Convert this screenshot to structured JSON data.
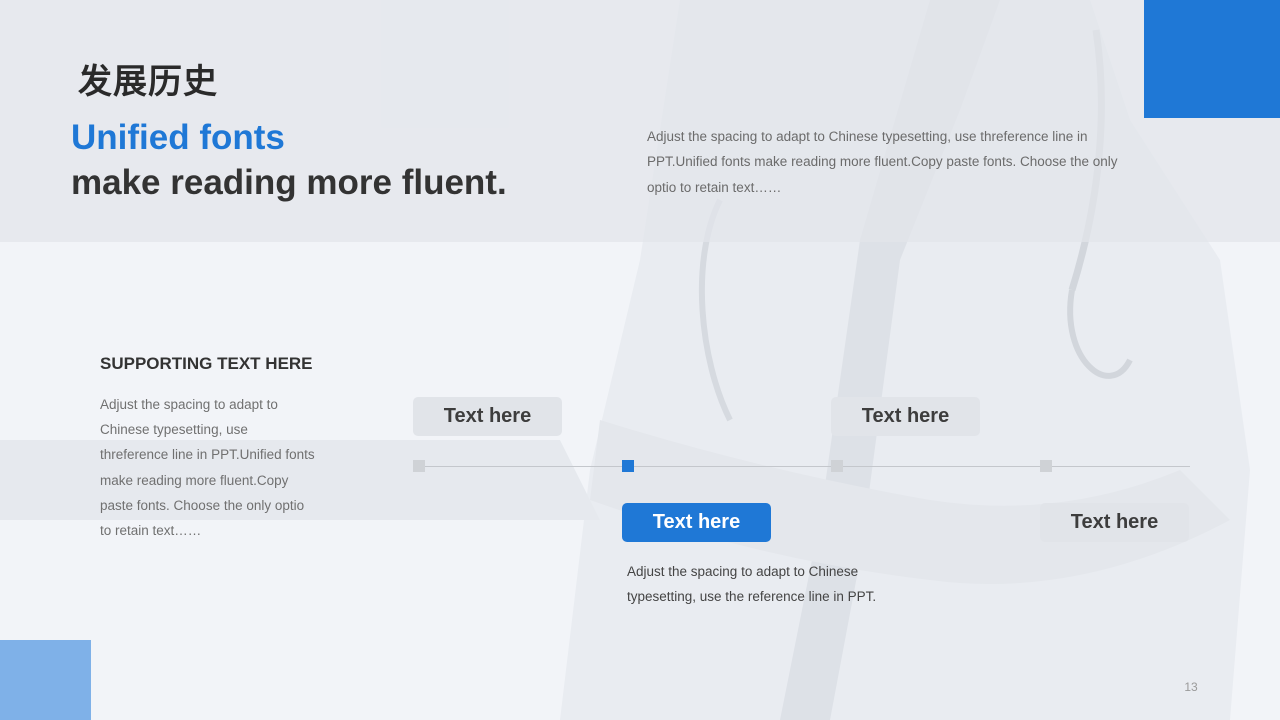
{
  "colors": {
    "accent": "#1f78d6",
    "accent_light": "#7fb1e8",
    "pill_inactive": "#e1e4e9",
    "pill_inactive_text": "#3d3d3d",
    "node_inactive": "#cfd2d6",
    "pill_active_text": "#ffffff"
  },
  "header": {
    "title": "发展历史",
    "headline_line1": "Unified fonts",
    "headline_line2": "make reading more fluent.",
    "description": "Adjust the spacing to adapt to Chinese typesetting, use threference line in PPT.Unified fonts make reading more fluent.Copy paste fonts. Choose the only optio to retain text……"
  },
  "supporting": {
    "title": "SUPPORTING TEXT HERE",
    "body": "Adjust the spacing to adapt to Chinese typesetting, use threference line in PPT.Unified fonts make reading more fluent.Copy paste fonts. Choose the only optio to retain text……"
  },
  "timeline": {
    "active_index": 1,
    "events": [
      {
        "label": "Text here",
        "position": "above"
      },
      {
        "label": "Text here",
        "position": "below"
      },
      {
        "label": "Text here",
        "position": "above"
      },
      {
        "label": "Text here",
        "position": "below"
      }
    ],
    "active_description": "Adjust the spacing to adapt to Chinese typesetting, use the reference line in PPT."
  },
  "page_number": "13"
}
